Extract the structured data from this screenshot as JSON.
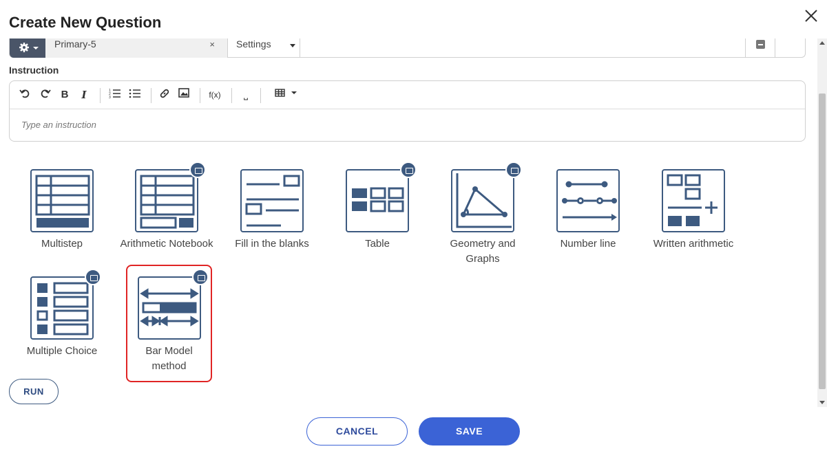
{
  "dialog": {
    "title": "Create New Question"
  },
  "topbar": {
    "grade_value": "Primary-5",
    "grade_clear": "×",
    "settings_label": "Settings"
  },
  "instruction": {
    "label": "Instruction",
    "placeholder": "Type an instruction",
    "toolbar": {
      "bold": "B",
      "italic": "I",
      "formula": "f(x)",
      "blank": "⎵"
    }
  },
  "question_types": [
    {
      "label": "Multistep",
      "icon": "multistep-icon",
      "has_folder": false
    },
    {
      "label": "Arithmetic Notebook",
      "icon": "arithmetic-notebook-icon",
      "has_folder": true
    },
    {
      "label": "Fill in the blanks",
      "icon": "fill-blanks-icon",
      "has_folder": false
    },
    {
      "label": "Table",
      "icon": "table-icon",
      "has_folder": true
    },
    {
      "label": "Geometry and Graphs",
      "icon": "geometry-icon",
      "has_folder": true
    },
    {
      "label": "Number line",
      "icon": "number-line-icon",
      "has_folder": false
    },
    {
      "label": "Written arithmetic",
      "icon": "written-arithmetic-icon",
      "has_folder": false
    },
    {
      "label": "Multiple Choice",
      "icon": "multiple-choice-icon",
      "has_folder": true
    },
    {
      "label": "Bar Model method",
      "icon": "bar-model-icon",
      "has_folder": true,
      "selected": true
    }
  ],
  "actions": {
    "run": "RUN",
    "cancel": "CANCEL",
    "save": "SAVE"
  },
  "colors": {
    "icon_stroke": "#3d5a80",
    "primary": "#3b63d6",
    "highlight": "#e02424"
  }
}
